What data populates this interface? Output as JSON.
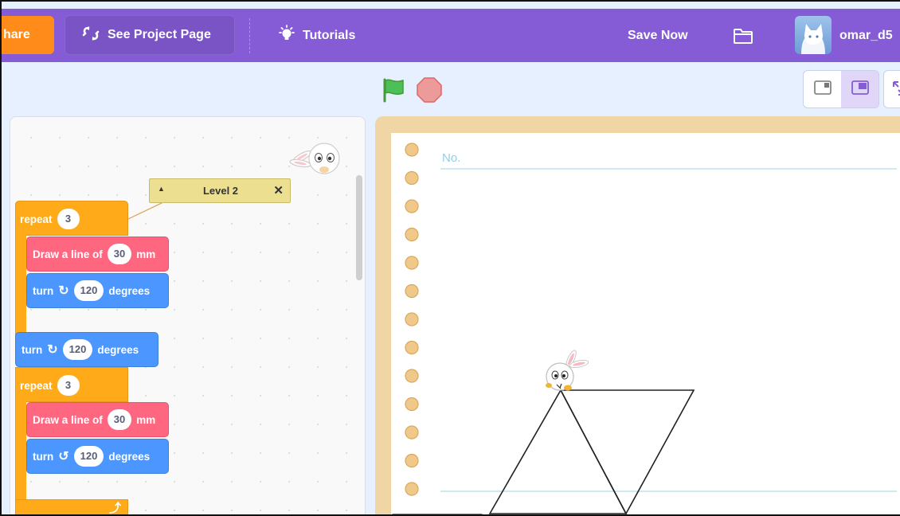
{
  "menubar": {
    "share_label": "hare",
    "project_page_label": "See Project Page",
    "tutorials_label": "Tutorials",
    "save_label": "Save Now",
    "username": "omar_d5"
  },
  "comment": {
    "text": "Level 2"
  },
  "blocks": {
    "repeat1": {
      "label": "repeat",
      "count": "3"
    },
    "draw1": {
      "prefix": "Draw a line of",
      "value": "30",
      "unit": "mm"
    },
    "turn1": {
      "prefix": "turn",
      "value": "120",
      "suffix": "degrees"
    },
    "turn_mid": {
      "prefix": "turn",
      "value": "120",
      "suffix": "degrees"
    },
    "repeat2": {
      "label": "repeat",
      "count": "3"
    },
    "draw2": {
      "prefix": "Draw a line of",
      "value": "30",
      "unit": "mm"
    },
    "turn2": {
      "prefix": "turn",
      "value": "120",
      "suffix": "degrees"
    }
  },
  "stage": {
    "notebook_label": "No."
  },
  "colors": {
    "menubar": "#855cd6",
    "share": "#ff8c1a",
    "control_block": "#ffab19",
    "pen_block": "#ff6680",
    "motion_block": "#4c97ff",
    "comment": "#ecdf90"
  }
}
